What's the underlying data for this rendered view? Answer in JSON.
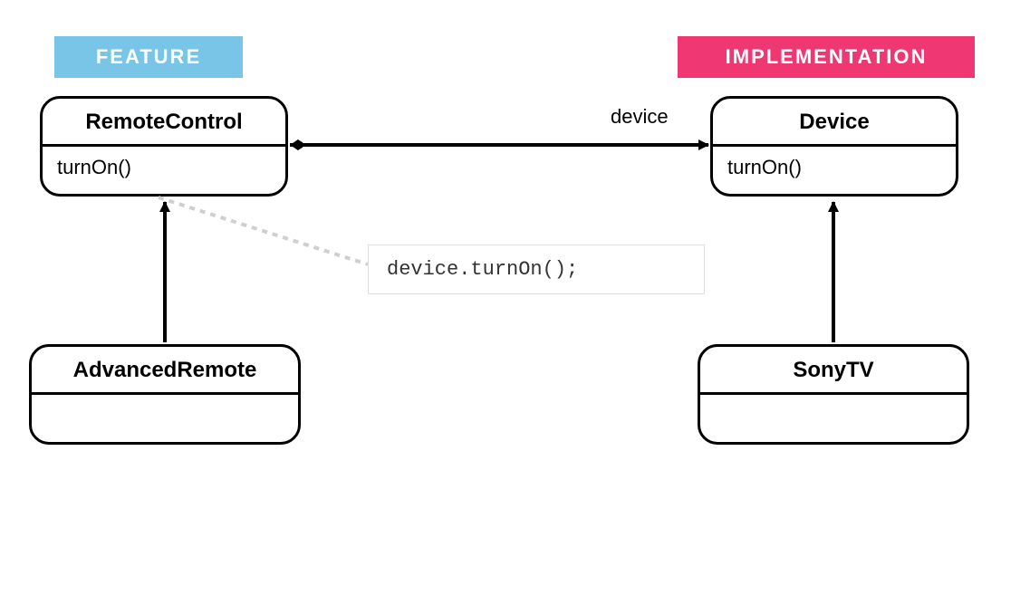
{
  "labels": {
    "feature": "FEATURE",
    "implementation": "IMPLEMENTATION",
    "association": "device"
  },
  "classes": {
    "remoteControl": {
      "name": "RemoteControl",
      "method": "turnOn()"
    },
    "device": {
      "name": "Device",
      "method": "turnOn()"
    },
    "advancedRemote": {
      "name": "AdvancedRemote",
      "method": ""
    },
    "sonyTV": {
      "name": "SonyTV",
      "method": ""
    }
  },
  "note": {
    "code": "device.turnOn();"
  }
}
